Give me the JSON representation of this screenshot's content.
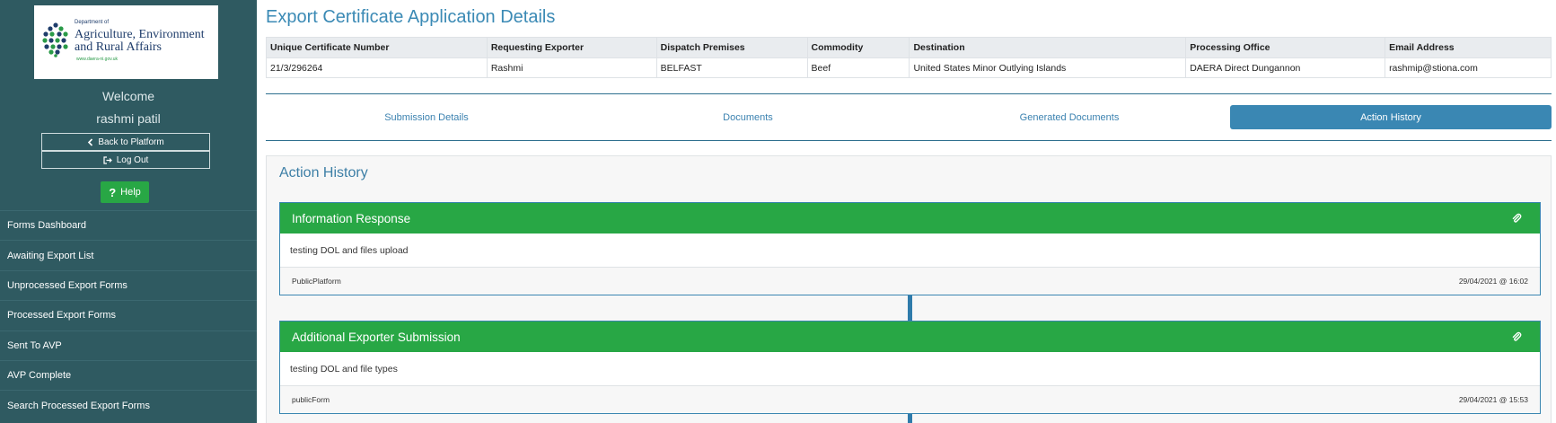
{
  "sidebar": {
    "logo": {
      "dept": "Department of",
      "line1": "Agriculture, Environment",
      "line2": "and Rural Affairs",
      "url": "www.daera-ni.gov.uk"
    },
    "welcome": "Welcome",
    "user_name": "rashmi patil",
    "back_label": "Back to Platform",
    "logout_label": "Log Out",
    "help_label": "Help",
    "nav_items": [
      "Forms Dashboard",
      "Awaiting Export List",
      "Unprocessed Export Forms",
      "Processed Export Forms",
      "Sent To AVP",
      "AVP Complete",
      "Search Processed Export Forms"
    ]
  },
  "page": {
    "title": "Export Certificate Application Details"
  },
  "summary_table": {
    "headers": [
      "Unique Certificate Number",
      "Requesting Exporter",
      "Dispatch Premises",
      "Commodity",
      "Destination",
      "Processing Office",
      "Email Address"
    ],
    "row": [
      "21/3/296264",
      "Rashmi",
      "BELFAST",
      "Beef",
      "United States Minor Outlying Islands",
      "DAERA Direct Dungannon",
      "rashmip@stiona.com"
    ]
  },
  "tabs": [
    {
      "label": "Submission Details",
      "active": false
    },
    {
      "label": "Documents",
      "active": false
    },
    {
      "label": "Generated Documents",
      "active": false
    },
    {
      "label": "Action History",
      "active": true
    }
  ],
  "action_history": {
    "title": "Action History",
    "entries": [
      {
        "heading": "Information Response",
        "body": "testing DOL and files upload",
        "source": "PublicPlatform",
        "timestamp": "29/04/2021 @ 16:02",
        "icon": "paperclip-icon"
      },
      {
        "heading": "Additional Exporter Submission",
        "body": "testing DOL and file types",
        "source": "publicForm",
        "timestamp": "29/04/2021 @ 15:53",
        "icon": "paperclip-icon"
      }
    ]
  },
  "colors": {
    "sidebar_bg": "#2f5a61",
    "accent_blue": "#3a87b3",
    "success_green": "#28a745",
    "title_blue": "#3b8ab5"
  }
}
